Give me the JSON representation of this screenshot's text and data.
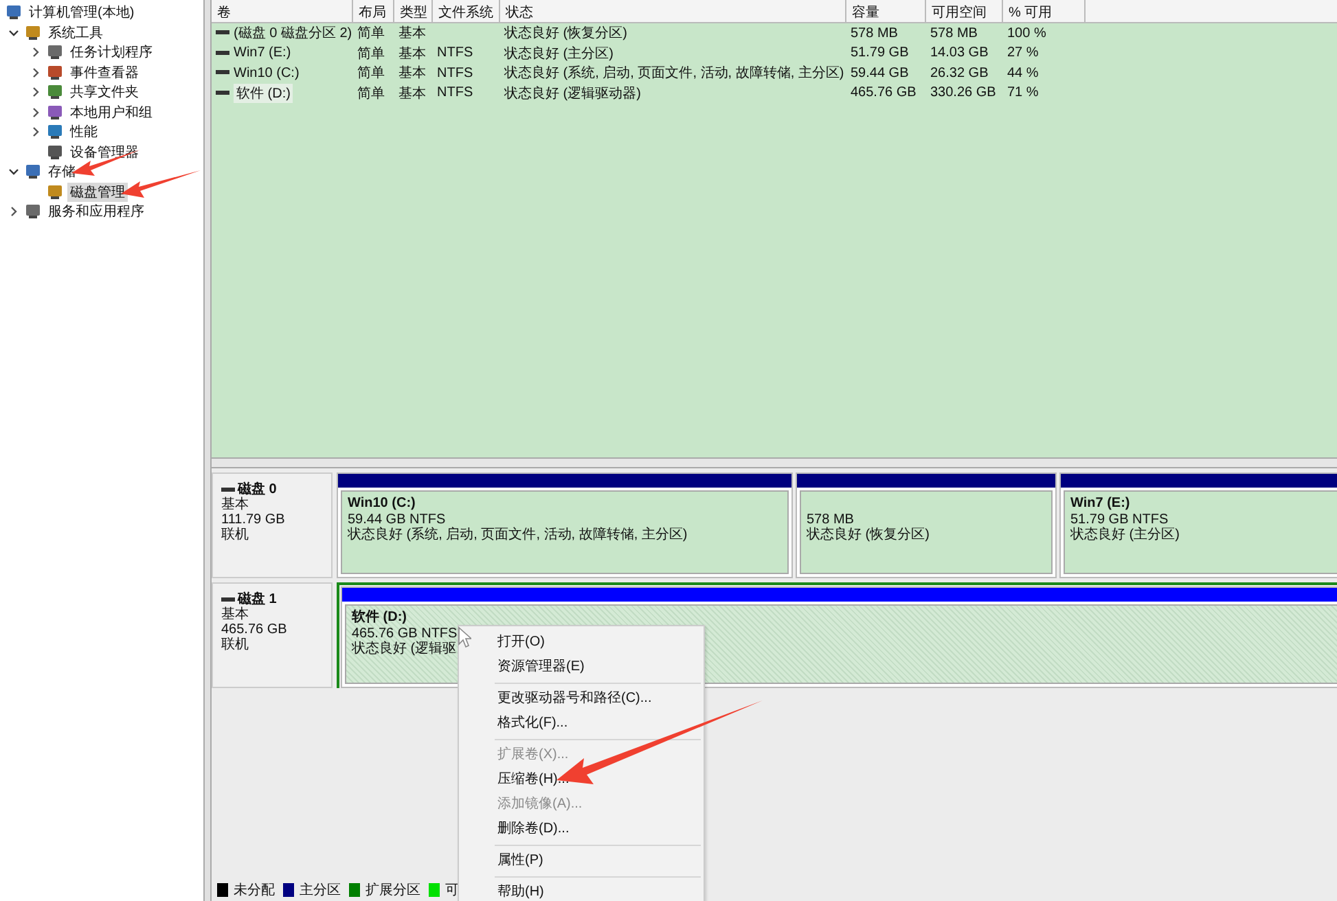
{
  "tree": [
    {
      "label": "计算机管理(本地)",
      "selected": false,
      "children": [
        {
          "label": "系统工具",
          "expanded": true,
          "selected": false,
          "children": [
            {
              "label": "任务计划程序",
              "expanded": false,
              "selected": false
            },
            {
              "label": "事件查看器",
              "expanded": false,
              "selected": false
            },
            {
              "label": "共享文件夹",
              "expanded": false,
              "selected": false
            },
            {
              "label": "本地用户和组",
              "expanded": false,
              "selected": false
            },
            {
              "label": "性能",
              "expanded": false,
              "selected": false
            },
            {
              "label": "设备管理器",
              "selected": false
            }
          ]
        },
        {
          "label": "存储",
          "expanded": true,
          "selected": false,
          "children": [
            {
              "label": "磁盘管理",
              "selected": true
            }
          ]
        },
        {
          "label": "服务和应用程序",
          "expanded": false,
          "selected": false
        }
      ]
    }
  ],
  "table": {
    "columns": [
      "卷",
      "布局",
      "类型",
      "文件系统",
      "状态",
      "容量",
      "可用空间",
      "% 可用"
    ],
    "rows": [
      {
        "selected": false,
        "cells": [
          "(磁盘 0 磁盘分区 2)",
          "简单",
          "基本",
          "",
          "状态良好 (恢复分区)",
          "578 MB",
          "578 MB",
          "100 %"
        ]
      },
      {
        "selected": false,
        "cells": [
          "Win7 (E:)",
          "简单",
          "基本",
          "NTFS",
          "状态良好 (主分区)",
          "51.79 GB",
          "14.03 GB",
          "27 %"
        ]
      },
      {
        "selected": false,
        "cells": [
          "Win10 (C:)",
          "简单",
          "基本",
          "NTFS",
          "状态良好 (系统, 启动, 页面文件, 活动, 故障转储, 主分区)",
          "59.44 GB",
          "26.32 GB",
          "44 %"
        ]
      },
      {
        "selected": true,
        "cells": [
          "软件 (D:)",
          "简单",
          "基本",
          "NTFS",
          "状态良好 (逻辑驱动器)",
          "465.76 GB",
          "330.26 GB",
          "71 %"
        ]
      }
    ]
  },
  "disks": [
    {
      "name": "磁盘 0",
      "type": "基本",
      "size": "111.79 GB",
      "status": "联机",
      "partitions": [
        {
          "kind": "primary",
          "selected": false,
          "name": "Win10  (C:)",
          "size": "59.44 GB NTFS",
          "status": "状态良好 (系统, 启动, 页面文件, 活动, 故障转储, 主分区)"
        },
        {
          "kind": "primary",
          "selected": false,
          "size": "578 MB",
          "status": "状态良好 (恢复分区)"
        },
        {
          "kind": "primary",
          "selected": false,
          "name": "Win7  (E:)",
          "size": "51.79 GB NTFS",
          "status": "状态良好 (主分区)"
        }
      ]
    },
    {
      "name": "磁盘 1",
      "type": "基本",
      "size": "465.76 GB",
      "status": "联机",
      "partitions": [
        {
          "kind": "logical",
          "selected": true,
          "name": "软件  (D:)",
          "size": "465.76 GB NTFS",
          "status": "状态良好 (逻辑驱"
        }
      ]
    }
  ],
  "legend": [
    {
      "label": "未分配",
      "color": "#000000"
    },
    {
      "label": "主分区",
      "color": "#000080"
    },
    {
      "label": "扩展分区",
      "color": "#007f00"
    },
    {
      "label": "可",
      "color": "#00e000"
    }
  ],
  "context_menu": [
    {
      "kind": "item",
      "label": "打开(O)",
      "disabled": false
    },
    {
      "kind": "item",
      "label": "资源管理器(E)",
      "disabled": false
    },
    {
      "kind": "separator"
    },
    {
      "kind": "item",
      "label": "更改驱动器号和路径(C)...",
      "disabled": false
    },
    {
      "kind": "item",
      "label": "格式化(F)...",
      "disabled": false
    },
    {
      "kind": "separator"
    },
    {
      "kind": "item",
      "label": "扩展卷(X)...",
      "disabled": true
    },
    {
      "kind": "item",
      "label": "压缩卷(H)...",
      "disabled": false
    },
    {
      "kind": "item",
      "label": "添加镜像(A)...",
      "disabled": true
    },
    {
      "kind": "item",
      "label": "删除卷(D)...",
      "disabled": false
    },
    {
      "kind": "separator"
    },
    {
      "kind": "item",
      "label": "属性(P)",
      "disabled": false
    },
    {
      "kind": "separator"
    },
    {
      "kind": "item",
      "label": "帮助(H)",
      "disabled": false
    }
  ]
}
